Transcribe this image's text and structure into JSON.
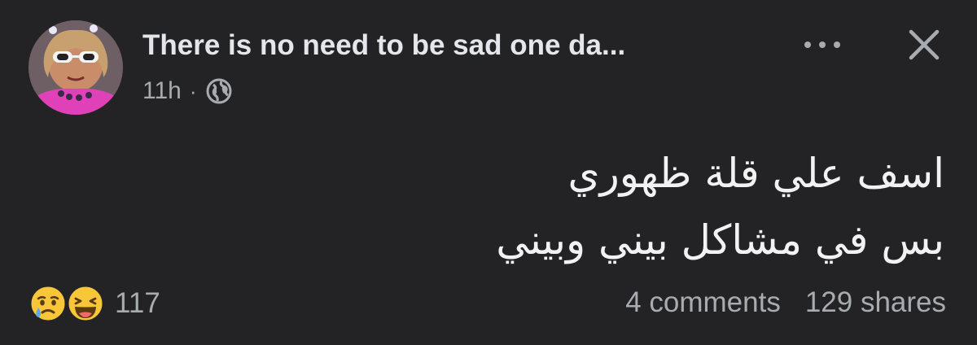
{
  "post": {
    "author": "There is no need to be sad one da...",
    "time": "11h",
    "separator": "·",
    "privacy_icon": "globe-icon",
    "more_icon": "more-horizontal-icon",
    "close_icon": "close-icon",
    "text_lines": [
      "اسف علي قلة ظهوري",
      "بس في مشاكل بيني وبيني"
    ],
    "reactions": {
      "icons": [
        "sad-reaction-icon",
        "haha-reaction-icon"
      ],
      "count": "117"
    },
    "comments": "4 comments",
    "shares": "129 shares"
  },
  "colors": {
    "background": "#232325",
    "primary_text": "#e4e6eb",
    "secondary_text": "#a8abaf",
    "reaction_yellow": "#f7c739"
  }
}
